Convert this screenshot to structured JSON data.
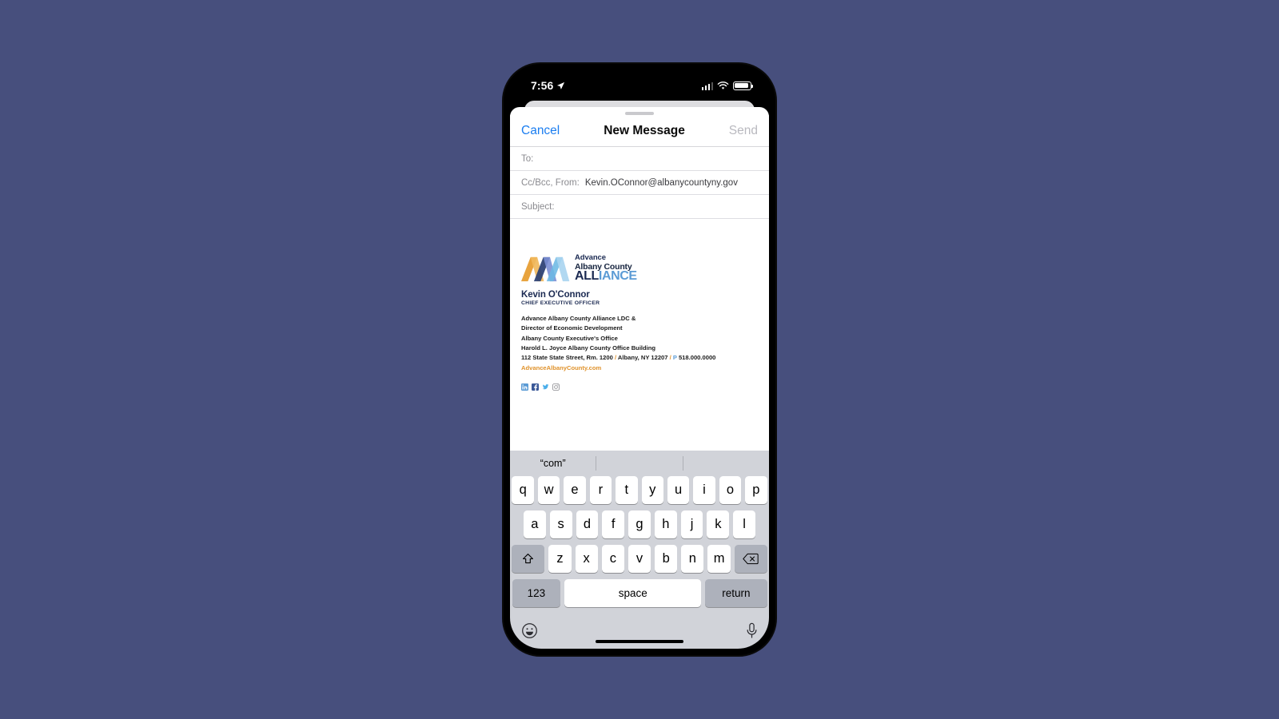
{
  "status_bar": {
    "time": "7:56",
    "location_icon": "location-arrow-icon",
    "signal_icon": "cellular-signal-icon",
    "wifi_icon": "wifi-icon",
    "battery_icon": "battery-icon"
  },
  "nav": {
    "cancel": "Cancel",
    "title": "New Message",
    "send": "Send"
  },
  "fields": {
    "to_label": "To:",
    "to_value": "",
    "ccbcc_label": "Cc/Bcc, From:",
    "ccbcc_value": "Kevin.OConnor@albanycountyny.gov",
    "subject_label": "Subject:",
    "subject_value": ""
  },
  "signature": {
    "logo": {
      "line1": "Advance",
      "line2": "Albany County",
      "line3_a": "ALL",
      "line3_b": "IANCE",
      "mark_colors": [
        "#e8a33d",
        "#2b3f73",
        "#7b8fd4",
        "#6cb8e4"
      ]
    },
    "name": "Kevin O'Connor",
    "role": "CHIEF EXECUTIVE OFFICER",
    "lines": [
      "Advance Albany County Alliance LDC &",
      "Director of Economic Development",
      "Albany County Executive's Office",
      "Harold L. Joyce Albany County Office Building"
    ],
    "address_street": "112 State State Street, Rm. 1200",
    "address_city": "Albany, NY 12207",
    "phone_marker": "P",
    "phone": "518.000.0000",
    "separator": "/",
    "website": "AdvanceAlbanyCounty.com",
    "socials": [
      "linkedin-icon",
      "facebook-icon",
      "twitter-icon",
      "instagram-icon"
    ],
    "accent_orange": "#e0922b",
    "accent_navy": "#1b2a52",
    "accent_blue": "#5b9bd5"
  },
  "keyboard": {
    "prediction": "“com”",
    "row1": [
      "q",
      "w",
      "e",
      "r",
      "t",
      "y",
      "u",
      "i",
      "o",
      "p"
    ],
    "row2": [
      "a",
      "s",
      "d",
      "f",
      "g",
      "h",
      "j",
      "k",
      "l"
    ],
    "row3": [
      "z",
      "x",
      "c",
      "v",
      "b",
      "n",
      "m"
    ],
    "shift_icon": "shift-arrow-icon",
    "delete_icon": "backspace-delete-icon",
    "numbers_key": "123",
    "space_key": "space",
    "return_key": "return",
    "emoji_icon": "emoji-smiley-icon",
    "dictation_icon": "microphone-icon"
  }
}
